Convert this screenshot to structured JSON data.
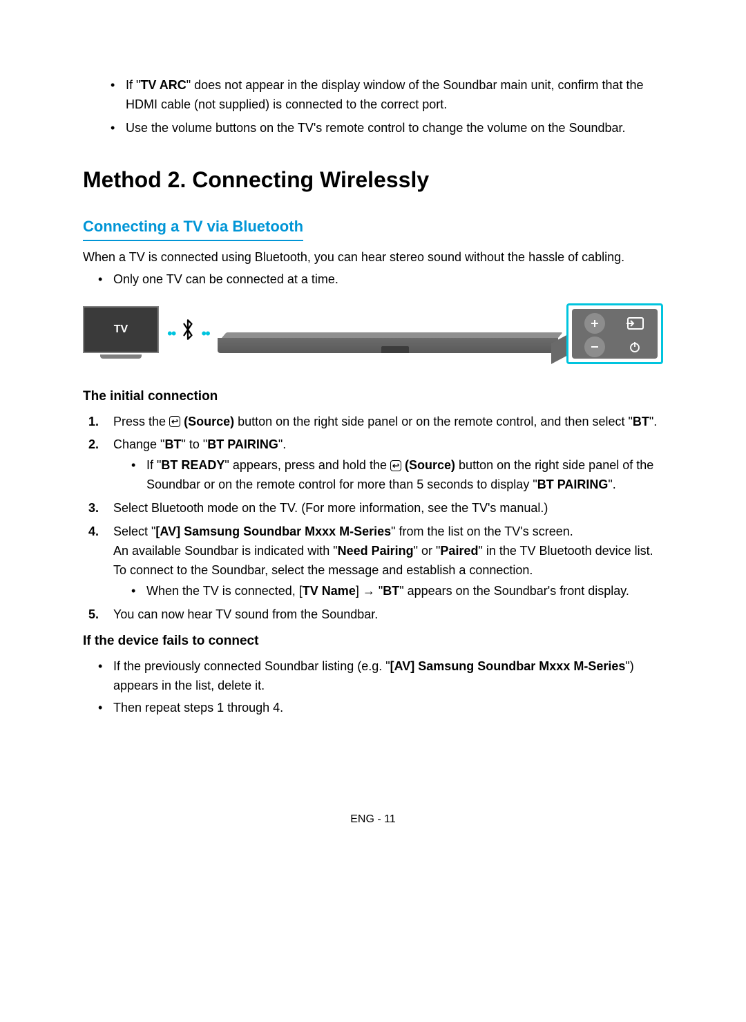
{
  "top": {
    "b1a": "If \"",
    "b1b": "TV ARC",
    "b1c": "\" does not appear in the display window of the Soundbar main unit, confirm that the HDMI cable (not supplied) is connected to the correct port.",
    "b2": "Use the volume buttons on the TV's remote control to change the volume on the Soundbar."
  },
  "method_heading": "Method 2. Connecting Wirelessly",
  "sub_heading": "Connecting a TV via Bluetooth",
  "intro": "When a TV is connected using Bluetooth, you can hear stereo sound without the hassle of cabling.",
  "intro_bullet": "Only one TV can be connected at a time.",
  "diagram": {
    "tv_label": "TV"
  },
  "h_initial": "The initial connection",
  "steps": {
    "s1a": "Press the ",
    "s1_btn": " (Source)",
    "s1b": " button on the right side panel or on the remote control, and then select \"",
    "s1c": "BT",
    "s1d": "\".",
    "s2a": "Change \"",
    "s2b": "BT",
    "s2c": "\" to \"",
    "s2d": "BT PAIRING",
    "s2e": "\".",
    "s2_sub_a": "If \"",
    "s2_sub_b": "BT READY",
    "s2_sub_c": "\" appears, press and hold the ",
    "s2_sub_btn": " (Source)",
    "s2_sub_d": " button on the right side panel of the Soundbar or on the remote control for more than 5 seconds to display \"",
    "s2_sub_e": "BT PAIRING",
    "s2_sub_f": "\".",
    "s3": "Select Bluetooth mode on the TV. (For more information, see the TV's manual.)",
    "s4a": "Select \"",
    "s4b": "[AV] Samsung Soundbar Mxxx M-Series",
    "s4c": "\" from the list on the TV's screen.",
    "s4d": "An available Soundbar is indicated with \"",
    "s4e": "Need Pairing",
    "s4f": "\" or \"",
    "s4g": "Paired",
    "s4h": "\" in the TV Bluetooth device list. To connect to the Soundbar, select the message and establish a connection.",
    "s4_sub_a": "When the TV is connected, [",
    "s4_sub_b": "TV Name",
    "s4_sub_c": "] → \"",
    "s4_sub_d": "BT",
    "s4_sub_e": "\" appears on the Soundbar's front display.",
    "s5": "You can now hear TV sound from the Soundbar."
  },
  "h_fail": "If the device fails to connect",
  "fail": {
    "f1a": "If the previously connected Soundbar listing (e.g. \"",
    "f1b": "[AV] Samsung Soundbar Mxxx M-Series",
    "f1c": "\") appears in the list, delete it.",
    "f2": "Then repeat steps 1 through 4."
  },
  "footer": "ENG - 11"
}
